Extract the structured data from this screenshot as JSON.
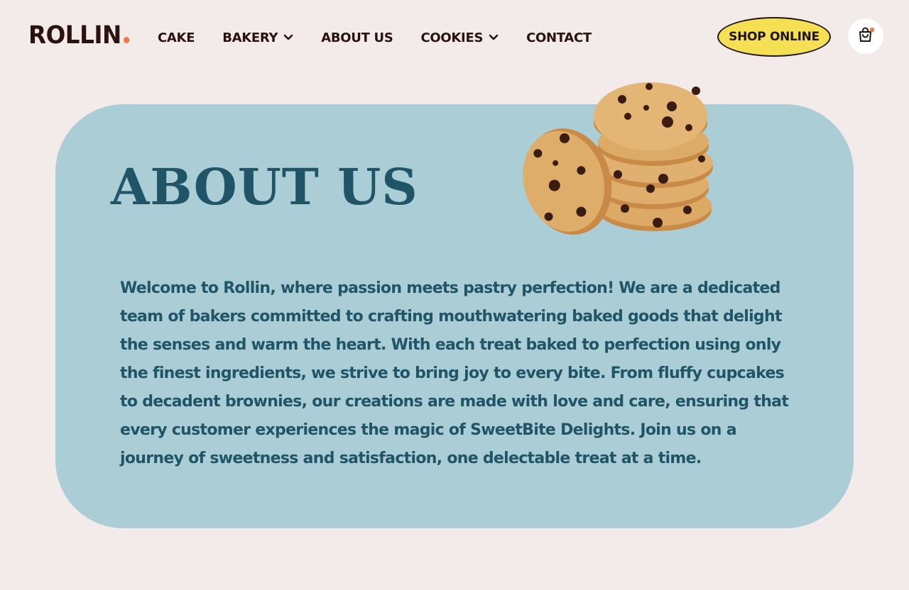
{
  "header": {
    "logo_text": "ROLLIN",
    "nav": [
      {
        "label": "CAKE",
        "has_dropdown": false
      },
      {
        "label": "BAKERY",
        "has_dropdown": true
      },
      {
        "label": "ABOUT US",
        "has_dropdown": false
      },
      {
        "label": "COOKIES",
        "has_dropdown": true
      },
      {
        "label": "CONTACT",
        "has_dropdown": false
      }
    ],
    "shop_label": "SHOP ONLINE",
    "cart_icon": "shopping-bag-icon"
  },
  "colors": {
    "background": "#f3ebe9",
    "panel": "#abcdd5",
    "heading": "#1f5566",
    "accent_dot": "#ef7a48",
    "button": "#f4e052"
  },
  "about": {
    "title": "ABOUT US",
    "body": "Welcome to Rollin, where passion meets pastry perfection! We are a dedicated team of bakers committed to crafting mouthwatering baked goods that delight the senses and warm the heart. With each treat baked to perfection using only the finest ingredients, we strive to bring joy to every bite. From fluffy cupcakes to decadent brownies, our creations are made with love and care, ensuring that every customer experiences the magic of SweetBite Delights. Join us on a journey of sweetness and satisfaction, one delectable treat at a time.",
    "image": "chocolate-chip-cookies"
  }
}
